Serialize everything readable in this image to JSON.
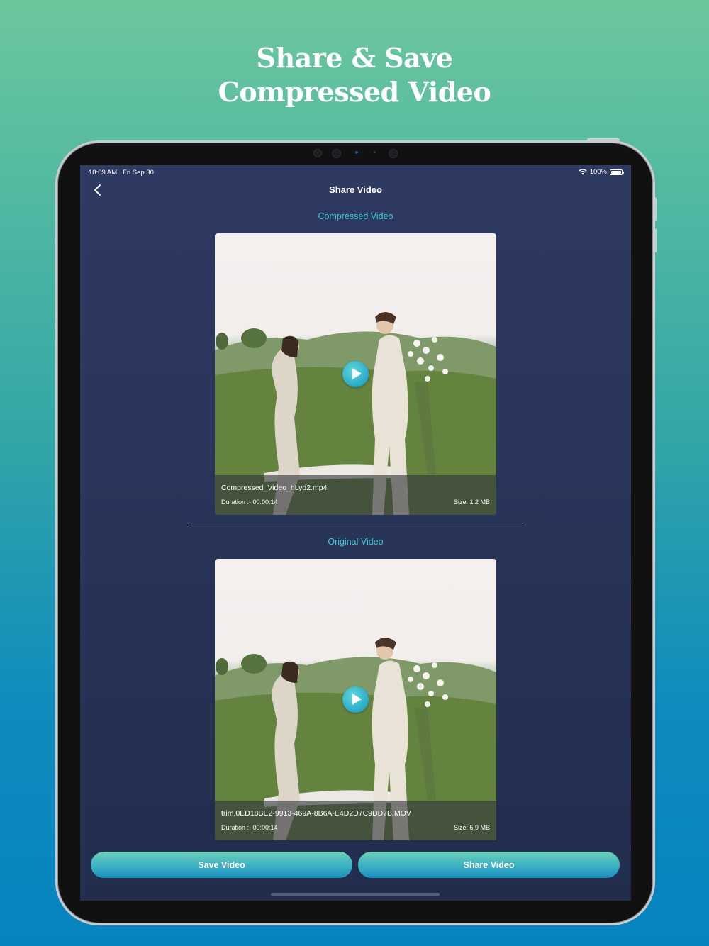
{
  "promo": {
    "line1": "Share & Save",
    "line2": "Compressed Video"
  },
  "status_bar": {
    "time": "10:09 AM",
    "date": "Fri Sep 30",
    "battery": "100%"
  },
  "nav": {
    "title": "Share Video",
    "back_icon": "chevron-left-icon"
  },
  "compressed": {
    "section_label": "Compressed Video",
    "file_name": "Compressed_Video_hLyd2.mp4",
    "duration": "Duration :- 00:00:14",
    "size": "Size: 1.2 MB"
  },
  "original": {
    "section_label": "Original Video",
    "file_name": "trim.0ED18BE2-9913-469A-8B6A-E4D2D7C9DD7B.MOV",
    "duration": "Duration :- 00:00:14",
    "size": "Size: 5.9 MB"
  },
  "actions": {
    "save_label": "Save Video",
    "share_label": "Share Video"
  },
  "colors": {
    "accent": "#3fc8d2",
    "screen_bg": "#2a355a",
    "button_start": "#6bd0b6",
    "button_end": "#1c8fbd"
  }
}
